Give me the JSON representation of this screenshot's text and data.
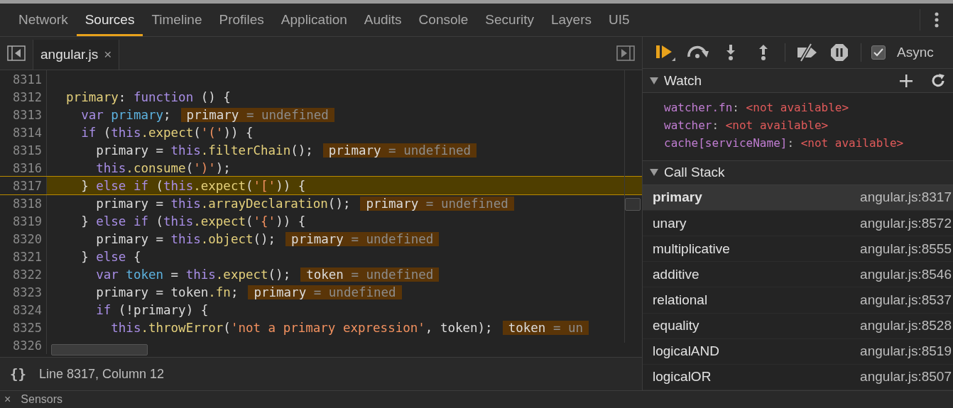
{
  "tabs": [
    {
      "label": "Network",
      "selected": false
    },
    {
      "label": "Sources",
      "selected": true
    },
    {
      "label": "Timeline",
      "selected": false
    },
    {
      "label": "Profiles",
      "selected": false
    },
    {
      "label": "Application",
      "selected": false
    },
    {
      "label": "Audits",
      "selected": false
    },
    {
      "label": "Console",
      "selected": false
    },
    {
      "label": "Security",
      "selected": false
    },
    {
      "label": "Layers",
      "selected": false
    },
    {
      "label": "UI5",
      "selected": false
    }
  ],
  "editor": {
    "file_tab": {
      "label": "angular.js",
      "close": "×"
    },
    "lines": [
      {
        "number": "8311",
        "current": false
      },
      {
        "number": "8312",
        "current": false,
        "tokens": [
          {
            "kind": "property",
            "text": "  primary"
          },
          {
            "kind": "plain",
            "text": ": "
          },
          {
            "kind": "keyword",
            "text": "function"
          },
          {
            "kind": "plain",
            "text": " () {"
          }
        ]
      },
      {
        "number": "8313",
        "current": false,
        "tokens": [
          {
            "kind": "keyword",
            "text": "    var"
          },
          {
            "kind": "variable",
            "text": " primary"
          },
          {
            "kind": "plain",
            "text": ";"
          }
        ],
        "inline_value": {
          "name": "primary",
          "operator": "=",
          "value": "undefined"
        }
      },
      {
        "number": "8314",
        "current": false,
        "tokens": [
          {
            "kind": "keyword",
            "text": "    if"
          },
          {
            "kind": "plain",
            "text": " ("
          },
          {
            "kind": "keyword",
            "text": "this"
          },
          {
            "kind": "property",
            "text": ".expect"
          },
          {
            "kind": "plain",
            "text": "("
          },
          {
            "kind": "string",
            "text": "'('"
          },
          {
            "kind": "plain",
            "text": ")) {"
          }
        ]
      },
      {
        "number": "8315",
        "current": false,
        "tokens": [
          {
            "kind": "plain",
            "text": "      primary = "
          },
          {
            "kind": "keyword",
            "text": "this"
          },
          {
            "kind": "property",
            "text": ".filterChain"
          },
          {
            "kind": "plain",
            "text": "();"
          }
        ],
        "inline_value": {
          "name": "primary",
          "operator": "=",
          "value": "undefined"
        }
      },
      {
        "number": "8316",
        "current": false,
        "tokens": [
          {
            "kind": "keyword",
            "text": "      this"
          },
          {
            "kind": "property",
            "text": ".consume"
          },
          {
            "kind": "plain",
            "text": "("
          },
          {
            "kind": "string",
            "text": "')'"
          },
          {
            "kind": "plain",
            "text": ");"
          }
        ]
      },
      {
        "number": "8317",
        "current": true,
        "tokens": [
          {
            "kind": "plain",
            "text": "    } "
          },
          {
            "kind": "keyword",
            "text": "else if"
          },
          {
            "kind": "plain",
            "text": " ("
          },
          {
            "kind": "keyword",
            "text": "this"
          },
          {
            "kind": "property",
            "text": ".expect"
          },
          {
            "kind": "plain",
            "text": "("
          },
          {
            "kind": "string",
            "text": "'['"
          },
          {
            "kind": "plain",
            "text": ")) {"
          }
        ]
      },
      {
        "number": "8318",
        "current": false,
        "tokens": [
          {
            "kind": "plain",
            "text": "      primary = "
          },
          {
            "kind": "keyword",
            "text": "this"
          },
          {
            "kind": "property",
            "text": ".arrayDeclaration"
          },
          {
            "kind": "plain",
            "text": "();"
          }
        ],
        "inline_value": {
          "name": "primary",
          "operator": "=",
          "value": "undefined"
        }
      },
      {
        "number": "8319",
        "current": false,
        "tokens": [
          {
            "kind": "plain",
            "text": "    } "
          },
          {
            "kind": "keyword",
            "text": "else if"
          },
          {
            "kind": "plain",
            "text": " ("
          },
          {
            "kind": "keyword",
            "text": "this"
          },
          {
            "kind": "property",
            "text": ".expect"
          },
          {
            "kind": "plain",
            "text": "("
          },
          {
            "kind": "string",
            "text": "'{'"
          },
          {
            "kind": "plain",
            "text": ")) {"
          }
        ]
      },
      {
        "number": "8320",
        "current": false,
        "tokens": [
          {
            "kind": "plain",
            "text": "      primary = "
          },
          {
            "kind": "keyword",
            "text": "this"
          },
          {
            "kind": "property",
            "text": ".object"
          },
          {
            "kind": "plain",
            "text": "();"
          }
        ],
        "inline_value": {
          "name": "primary",
          "operator": "=",
          "value": "undefined"
        }
      },
      {
        "number": "8321",
        "current": false,
        "tokens": [
          {
            "kind": "plain",
            "text": "    } "
          },
          {
            "kind": "keyword",
            "text": "else"
          },
          {
            "kind": "plain",
            "text": " {"
          }
        ]
      },
      {
        "number": "8322",
        "current": false,
        "tokens": [
          {
            "kind": "keyword",
            "text": "      var"
          },
          {
            "kind": "variable",
            "text": " token"
          },
          {
            "kind": "plain",
            "text": " = "
          },
          {
            "kind": "keyword",
            "text": "this"
          },
          {
            "kind": "property",
            "text": ".expect"
          },
          {
            "kind": "plain",
            "text": "();"
          }
        ],
        "inline_value": {
          "name": "token",
          "operator": "=",
          "value": "undefined"
        }
      },
      {
        "number": "8323",
        "current": false,
        "tokens": [
          {
            "kind": "plain",
            "text": "      primary = token"
          },
          {
            "kind": "property",
            "text": ".fn"
          },
          {
            "kind": "plain",
            "text": ";"
          }
        ],
        "inline_value": {
          "name": "primary",
          "operator": "=",
          "value": "undefined"
        }
      },
      {
        "number": "8324",
        "current": false,
        "tokens": [
          {
            "kind": "keyword",
            "text": "      if"
          },
          {
            "kind": "plain",
            "text": " (!primary) {"
          }
        ]
      },
      {
        "number": "8325",
        "current": false,
        "tokens": [
          {
            "kind": "keyword",
            "text": "        this"
          },
          {
            "kind": "property",
            "text": ".throwError"
          },
          {
            "kind": "plain",
            "text": "("
          },
          {
            "kind": "string",
            "text": "'not a primary expression'"
          },
          {
            "kind": "plain",
            "text": ", token);"
          }
        ],
        "inline_value": {
          "name": "token",
          "operator": "=",
          "value": "un"
        }
      },
      {
        "number": "8326",
        "current": false
      }
    ],
    "status": {
      "format_icon": "{}",
      "position": "Line 8317, Column 12"
    }
  },
  "debugger": {
    "async": {
      "label": "Async",
      "checked": true
    },
    "watch": {
      "title": "Watch",
      "expanded": true,
      "items": [
        {
          "name": "watcher.fn",
          "separator": ":",
          "value": "<not available>"
        },
        {
          "name": "watcher",
          "separator": ":",
          "value": "<not available>"
        },
        {
          "name": "cache[serviceName]",
          "separator": ":",
          "value": "<not available>"
        }
      ]
    },
    "call_stack": {
      "title": "Call Stack",
      "expanded": true,
      "frames": [
        {
          "name": "primary",
          "location": "angular.js:8317",
          "selected": true
        },
        {
          "name": "unary",
          "location": "angular.js:8572",
          "selected": false
        },
        {
          "name": "multiplicative",
          "location": "angular.js:8555",
          "selected": false
        },
        {
          "name": "additive",
          "location": "angular.js:8546",
          "selected": false
        },
        {
          "name": "relational",
          "location": "angular.js:8537",
          "selected": false
        },
        {
          "name": "equality",
          "location": "angular.js:8528",
          "selected": false
        },
        {
          "name": "logicalAND",
          "location": "angular.js:8519",
          "selected": false
        },
        {
          "name": "logicalOR",
          "location": "angular.js:8507",
          "selected": false
        }
      ]
    }
  },
  "drawer": {
    "close": "×",
    "tab": "Sensors"
  }
}
